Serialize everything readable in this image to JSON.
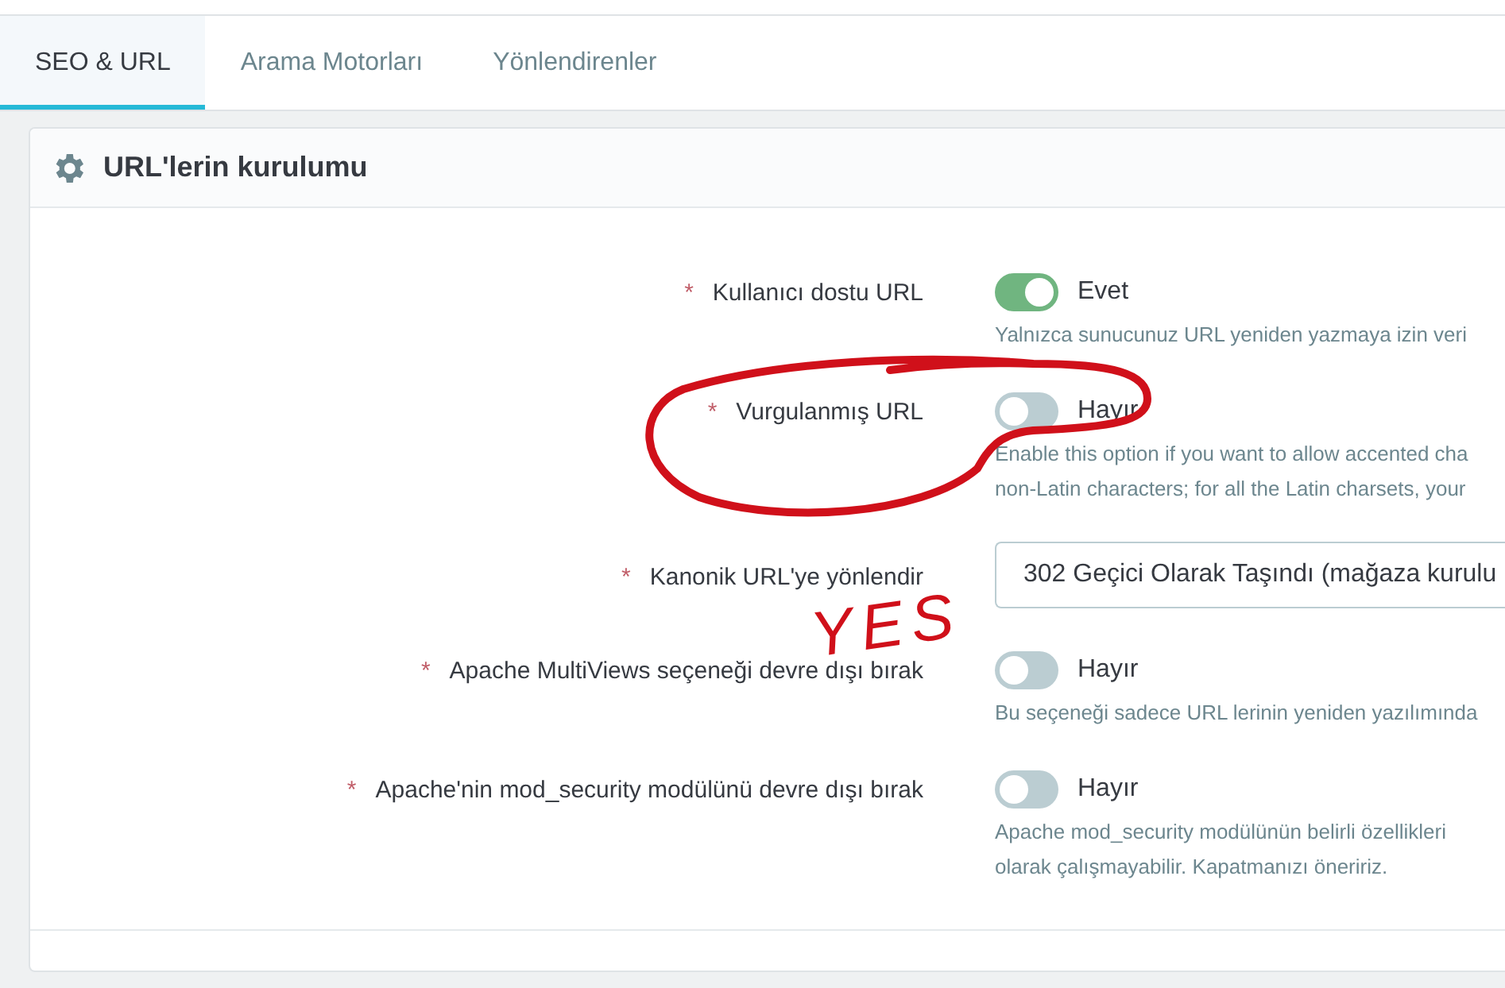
{
  "tabs": [
    {
      "label": "SEO & URL",
      "selected": true
    },
    {
      "label": "Arama Motorları",
      "selected": false
    },
    {
      "label": "Yönlendirenler",
      "selected": false
    }
  ],
  "panel": {
    "title": "URL'lerin kurulumu",
    "fields": [
      {
        "kind": "switch",
        "required": true,
        "label": "Kullanıcı dostu URL",
        "on": true,
        "value_label": "Evet",
        "help": [
          "Yalnızca sunucunuz URL yeniden yazmaya izin veri"
        ]
      },
      {
        "kind": "switch",
        "required": true,
        "label": "Vurgulanmış URL",
        "on": false,
        "value_label": "Hayır",
        "help": [
          "Enable this option if you want to allow accented cha",
          "non-Latin characters; for all the Latin charsets, your"
        ]
      },
      {
        "kind": "select",
        "required": true,
        "label": "Kanonik URL'ye yönlendir",
        "value": "302 Geçici Olarak Taşındı (mağaza kurulu"
      },
      {
        "kind": "switch",
        "required": true,
        "label": "Apache MultiViews seçeneği devre dışı bırak",
        "on": false,
        "value_label": "Hayır",
        "help": [
          "Bu seçeneği sadece URL lerinin yeniden yazılımında"
        ]
      },
      {
        "kind": "switch",
        "required": true,
        "label": "Apache'nin mod_security modülünü devre dışı bırak",
        "on": false,
        "value_label": "Hayır",
        "help": [
          "Apache mod_security modülünün belirli özellikleri",
          "olarak çalışmayabilir. Kapatmanızı öneririz."
        ]
      }
    ]
  },
  "required_mark": "*",
  "annotation": {
    "text": "YES"
  }
}
